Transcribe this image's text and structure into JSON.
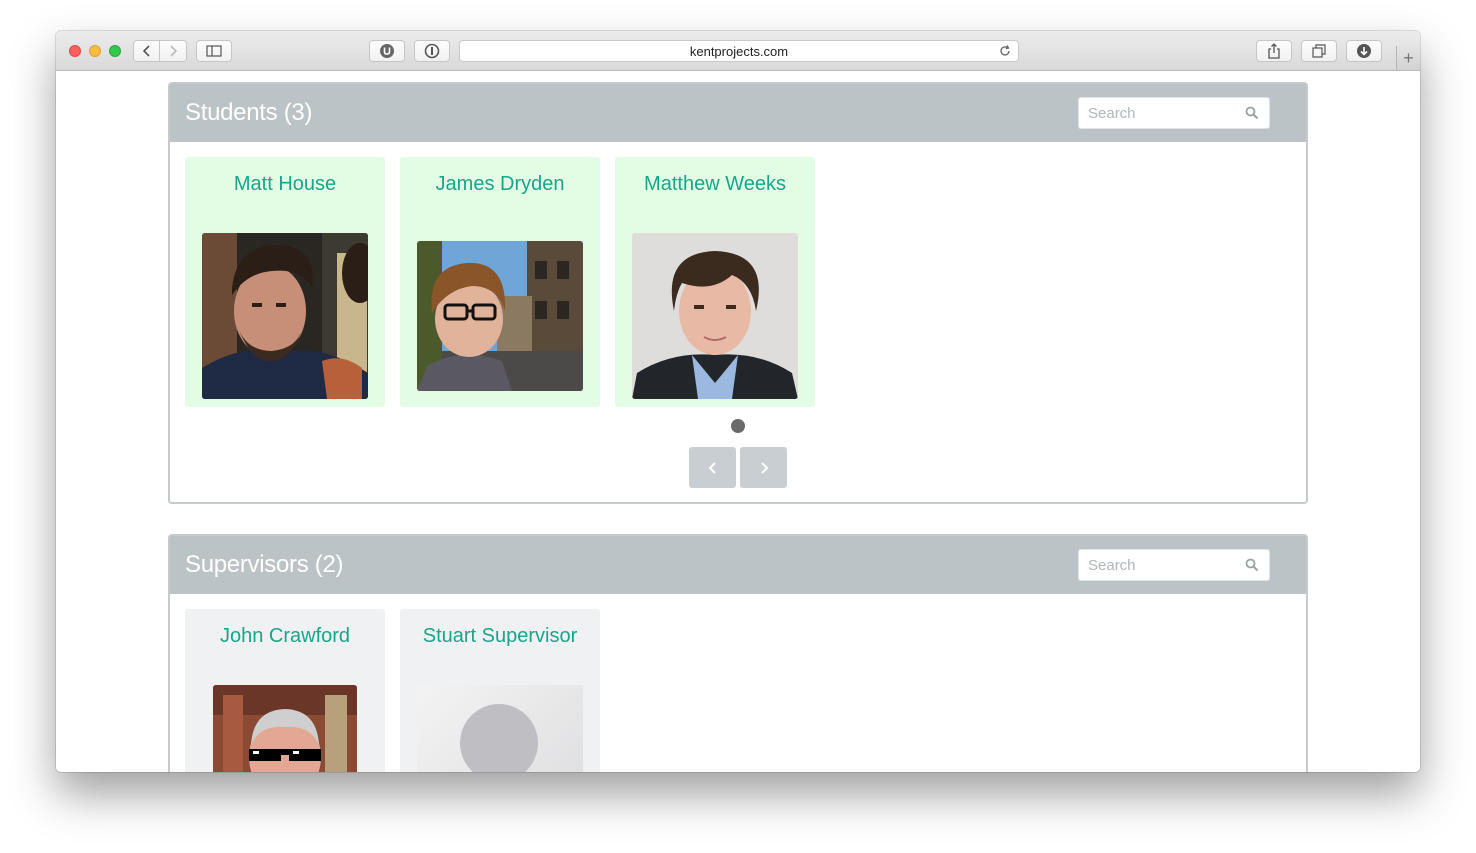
{
  "browser": {
    "url": "kentprojects.com",
    "icons": {
      "back": "chevron-left-icon",
      "forward": "chevron-right-icon",
      "sidebar": "sidebar-icon",
      "ublock": "ublock-icon",
      "onepassword": "onepassword-icon",
      "reload": "reload-icon",
      "share": "share-icon",
      "tabs": "tabs-icon",
      "downloads": "download-icon",
      "new_tab": "plus-icon"
    },
    "new_tab_label": "+"
  },
  "students": {
    "title": "Students (3)",
    "search_placeholder": "Search",
    "items": [
      {
        "name": "Matt House"
      },
      {
        "name": "James Dryden"
      },
      {
        "name": "Matthew Weeks"
      }
    ],
    "pagination": {
      "pages": 1,
      "current": 1
    }
  },
  "supervisors": {
    "title": "Supervisors (2)",
    "search_placeholder": "Search",
    "items": [
      {
        "name": "John Crawford"
      },
      {
        "name": "Stuart Supervisor"
      }
    ]
  },
  "colors": {
    "panel_header": "#bcc3c7",
    "student_card": "#e3fde5",
    "supervisor_card": "#eff1f2",
    "name_text": "#1aa48b"
  }
}
